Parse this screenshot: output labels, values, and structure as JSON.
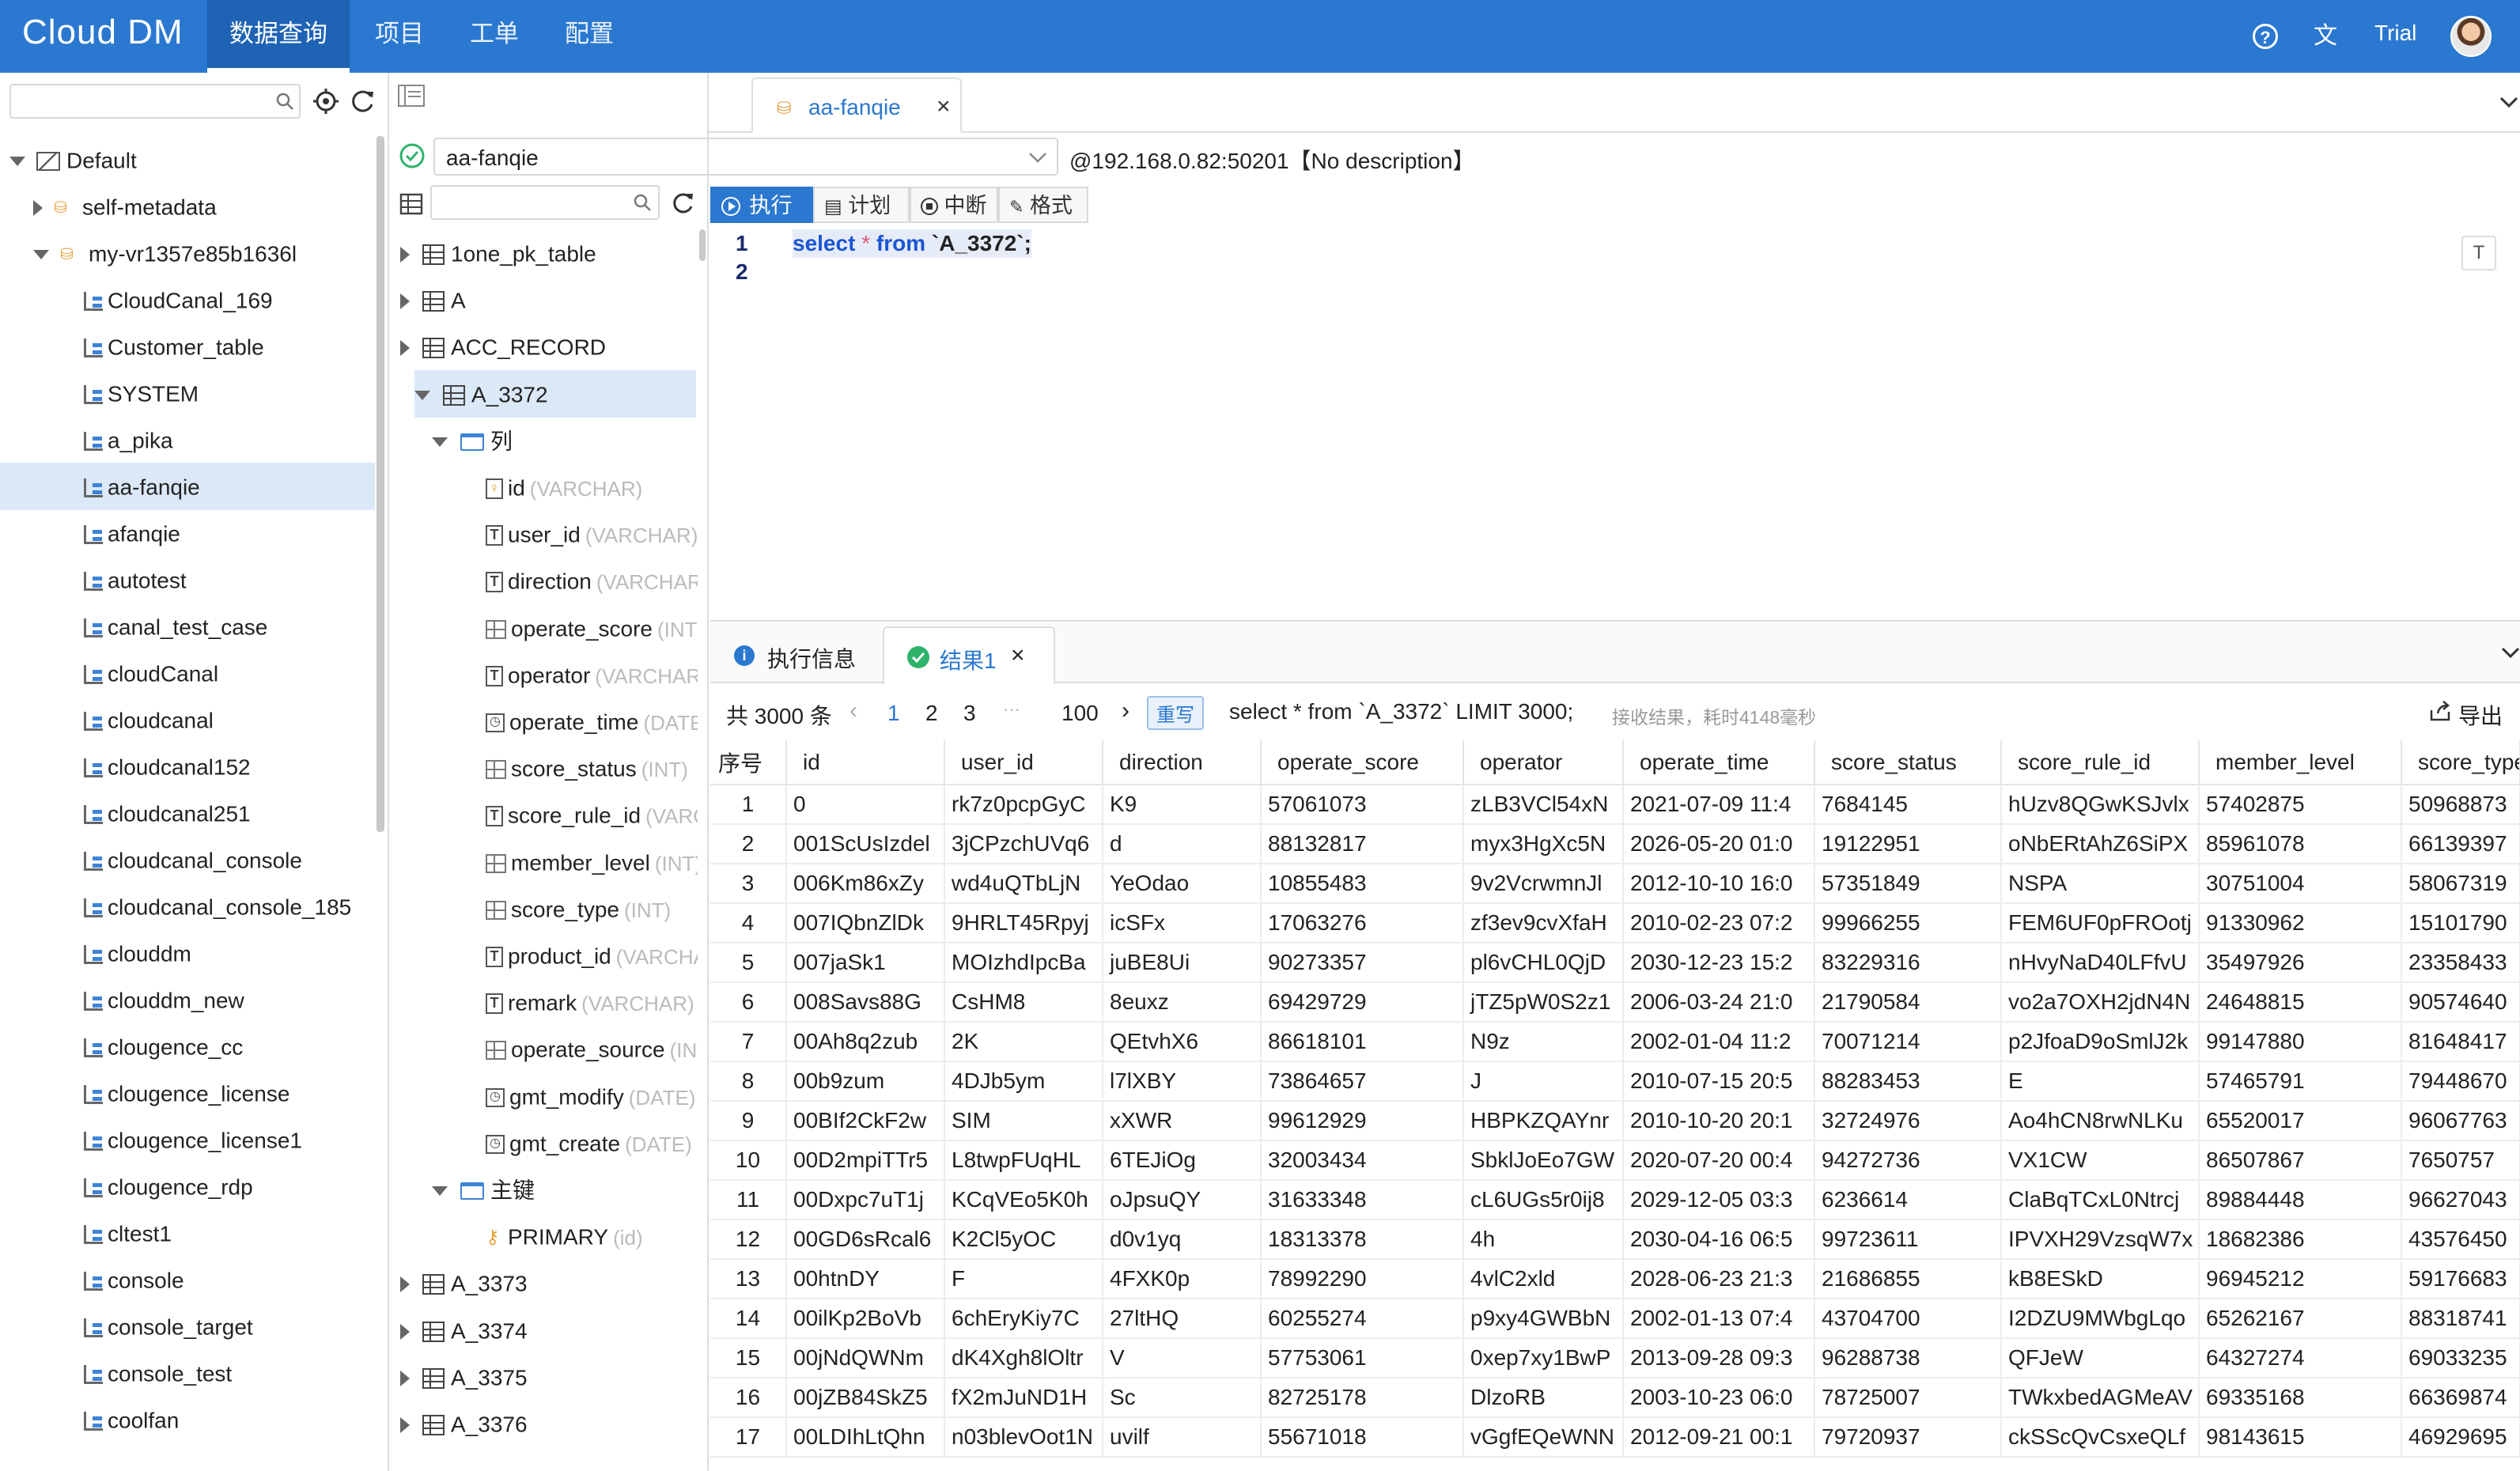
{
  "app": {
    "logo": "Cloud DM",
    "trial": "Trial"
  },
  "topnav": [
    "数据查询",
    "项目",
    "工单",
    "配置"
  ],
  "left_tree": {
    "root": "Default",
    "datasources": [
      {
        "name": "self-metadata",
        "expanded": false
      },
      {
        "name": "my-vr1357e85b1636l",
        "expanded": true
      }
    ],
    "schemas": [
      "CloudCanal_169",
      "Customer_table",
      "SYSTEM",
      "a_pika",
      "aa-fanqie",
      "afanqie",
      "autotest",
      "canal_test_case",
      "cloudCanal",
      "cloudcanal",
      "cloudcanal152",
      "cloudcanal251",
      "cloudcanal_console",
      "cloudcanal_console_185",
      "clouddm",
      "clouddm_new",
      "clougence_cc",
      "clougence_license",
      "clougence_license1",
      "clougence_rdp",
      "cltest1",
      "console",
      "console_target",
      "console_test",
      "coolfan"
    ],
    "selected": "aa-fanqie"
  },
  "editor_tab": {
    "title": "aa-fanqie",
    "close": "×"
  },
  "connection": {
    "schema": "aa-fanqie",
    "host": "@192.168.0.82:50201【No description】"
  },
  "toolbar": {
    "run": "执行",
    "plan": "计划",
    "stop": "中断",
    "format": "格式"
  },
  "mid_tree": {
    "tables_before": [
      "1one_pk_table",
      "A",
      "ACC_RECORD"
    ],
    "open_table": "A_3372",
    "columns_folder": "列",
    "columns": [
      {
        "name": "id",
        "type": "(VARCHAR)",
        "icon": "pk"
      },
      {
        "name": "user_id",
        "type": "(VARCHAR)",
        "icon": "text"
      },
      {
        "name": "direction",
        "type": "(VARCHAR)",
        "icon": "text"
      },
      {
        "name": "operate_score",
        "type": "(INT)",
        "icon": "num"
      },
      {
        "name": "operator",
        "type": "(VARCHAR)",
        "icon": "text"
      },
      {
        "name": "operate_time",
        "type": "(DATE)",
        "icon": "time"
      },
      {
        "name": "score_status",
        "type": "(INT)",
        "icon": "num"
      },
      {
        "name": "score_rule_id",
        "type": "(VARCHAR)",
        "icon": "text"
      },
      {
        "name": "member_level",
        "type": "(INT)",
        "icon": "num"
      },
      {
        "name": "score_type",
        "type": "(INT)",
        "icon": "num"
      },
      {
        "name": "product_id",
        "type": "(VARCHAR)",
        "icon": "text"
      },
      {
        "name": "remark",
        "type": "(VARCHAR)",
        "icon": "text"
      },
      {
        "name": "operate_source",
        "type": "(INT)",
        "icon": "num"
      },
      {
        "name": "gmt_modify",
        "type": "(DATE)",
        "icon": "time"
      },
      {
        "name": "gmt_create",
        "type": "(DATE)",
        "icon": "time"
      }
    ],
    "keys_folder": "主键",
    "primary": {
      "name": "PRIMARY",
      "type": "(id)"
    },
    "tables_after": [
      "A_3373",
      "A_3374",
      "A_3375",
      "A_3376"
    ]
  },
  "code": {
    "line1": "1",
    "line2": "2",
    "kw_select": "select",
    "star": "*",
    "kw_from": "from",
    "table": "`A_3372`",
    "semi": ";",
    "side_btn": "T"
  },
  "result_tabs": {
    "info": "执行信息",
    "result": "结果1",
    "close": "×"
  },
  "pager": {
    "total": "共 3000 条",
    "pages": [
      "1",
      "2",
      "3"
    ],
    "ellipsis": "···",
    "last": "100",
    "rewrite": "重写",
    "sql": "select * from `A_3372` LIMIT 3000;",
    "timing": "接收结果，耗时4148毫秒",
    "export": "导出"
  },
  "table": {
    "headers": [
      "序号",
      "id",
      "user_id",
      "direction",
      "operate_score",
      "operator",
      "operate_time",
      "score_status",
      "score_rule_id",
      "member_level",
      "score_type"
    ],
    "rows": [
      [
        "1",
        "0",
        "rk7z0pcpGyC",
        "K9",
        "57061073",
        "zLB3VCl54xN",
        "2021-07-09 11:4",
        "7684145",
        "hUzv8QGwKSJvlx",
        "57402875",
        "50968873"
      ],
      [
        "2",
        "001ScUsIzdel",
        "3jCPzchUVq6",
        "d",
        "88132817",
        "myx3HgXc5N",
        "2026-05-20 01:0",
        "19122951",
        "oNbERtAhZ6SiPX",
        "85961078",
        "66139397"
      ],
      [
        "3",
        "006Km86xZy",
        "wd4uQTbLjN",
        "YeOdao",
        "10855483",
        "9v2VcrwmnJl",
        "2012-10-10 16:0",
        "57351849",
        "NSPA",
        "30751004",
        "58067319"
      ],
      [
        "4",
        "007IQbnZlDk",
        "9HRLT45Rpyj",
        "icSFx",
        "17063276",
        "zf3ev9cvXfaH",
        "2010-02-23 07:2",
        "99966255",
        "FEM6UF0pFROotj",
        "91330962",
        "15101790"
      ],
      [
        "5",
        "007jaSk1",
        "MOIzhdIpcBa",
        "juBE8Ui",
        "90273357",
        "pl6vCHL0QjD",
        "2030-12-23 15:2",
        "83229316",
        "nHvyNaD40LFfvU",
        "35497926",
        "23358433"
      ],
      [
        "6",
        "008Savs88G",
        "CsHM8",
        "8euxz",
        "69429729",
        "jTZ5pW0S2z1",
        "2006-03-24 21:0",
        "21790584",
        "vo2a7OXH2jdN4N",
        "24648815",
        "90574640"
      ],
      [
        "7",
        "00Ah8q2zub",
        "2K",
        "QEtvhX6",
        "86618101",
        "N9z",
        "2002-01-04 11:2",
        "70071214",
        "p2JfoaD9oSmlJ2k",
        "99147880",
        "81648417"
      ],
      [
        "8",
        "00b9zum",
        "4DJb5ym",
        "l7lXBY",
        "73864657",
        "J",
        "2010-07-15 20:5",
        "88283453",
        "E",
        "57465791",
        "79448670"
      ],
      [
        "9",
        "00BIf2CkF2w",
        "SIM",
        "xXWR",
        "99612929",
        "HBPKZQAYnr",
        "2010-10-20 20:1",
        "32724976",
        "Ao4hCN8rwNLKu",
        "65520017",
        "96067763"
      ],
      [
        "10",
        "00D2mpiTTr5",
        "L8twpFUqHL",
        "6TEJiOg",
        "32003434",
        "SbklJoEo7GW",
        "2020-07-20 00:4",
        "94272736",
        "VX1CW",
        "86507867",
        "7650757"
      ],
      [
        "11",
        "00Dxpc7uT1j",
        "KCqVEo5K0h",
        "oJpsuQY",
        "31633348",
        "cL6UGs5r0ij8",
        "2029-12-05 03:3",
        "6236614",
        "ClaBqTCxL0Ntrcj",
        "89884448",
        "96627043"
      ],
      [
        "12",
        "00GD6sRcal6",
        "K2Cl5yOC",
        "d0v1yq",
        "18313378",
        "4h",
        "2030-04-16 06:5",
        "99723611",
        "IPVXH29VzsqW7x",
        "18682386",
        "43576450"
      ],
      [
        "13",
        "00htnDY",
        "F",
        "4FXK0p",
        "78992290",
        "4vlC2xld",
        "2028-06-23 21:3",
        "21686855",
        "kB8ESkD",
        "96945212",
        "59176683"
      ],
      [
        "14",
        "00ilKp2BoVb",
        "6chEryKiy7C",
        "27ltHQ",
        "60255274",
        "p9xy4GWBbN",
        "2002-01-13 07:4",
        "43704700",
        "I2DZU9MWbgLqo",
        "65262167",
        "88318741"
      ],
      [
        "15",
        "00jNdQWNm",
        "dK4Xgh8lOltr",
        "V",
        "57753061",
        "0xep7xy1BwP",
        "2013-09-28 09:3",
        "96288738",
        "QFJeW",
        "64327274",
        "69033235"
      ],
      [
        "16",
        "00jZB84SkZ5",
        "fX2mJuND1H",
        "Sc",
        "82725178",
        "DlzoRB",
        "2003-10-23 06:0",
        "78725007",
        "TWkxbedAGMeAV",
        "69335168",
        "66369874"
      ],
      [
        "17",
        "00LDIhLtQhn",
        "n03blevOot1N",
        "uvilf",
        "55671018",
        "vGgfEQeWNN",
        "2012-09-21 00:1",
        "79720937",
        "ckSScQvCsxeQLf",
        "98143615",
        "46929695"
      ]
    ]
  },
  "colors": {
    "brand": "#2b78d0",
    "selected_row": "#dbe8f7",
    "keyword": "#1a55d4",
    "success": "#2fb36b"
  }
}
